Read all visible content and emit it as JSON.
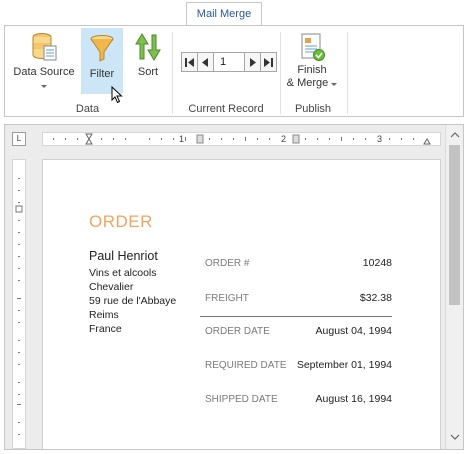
{
  "ribbon": {
    "tab_label": "Mail Merge",
    "groups": {
      "data": {
        "label": "Data",
        "data_source_label": "Data Source",
        "filter_label": "Filter",
        "sort_label": "Sort"
      },
      "current_record": {
        "label": "Current Record",
        "record_value": "1"
      },
      "publish": {
        "label": "Publish",
        "finish_merge_line1": "Finish",
        "finish_merge_line2": "& Merge"
      }
    },
    "accent_color": "#cde6f7"
  },
  "ruler": {
    "corner_label": "L",
    "marks": [
      "1",
      "2",
      "3"
    ]
  },
  "document": {
    "title": "ORDER",
    "title_color": "#f0a55f",
    "customer": {
      "name": "Paul Henriot",
      "lines": [
        "Vins et alcools",
        "Chevalier",
        "59 rue de l'Abbaye",
        "Reims",
        "France"
      ]
    },
    "fields": [
      {
        "label": "ORDER #",
        "value": "10248"
      },
      {
        "label": "FREIGHT",
        "value": "$32.38"
      },
      {
        "label": "ORDER DATE",
        "value": "August 04, 1994"
      },
      {
        "label": "REQUIRED DATE",
        "value": "September 01, 1994"
      },
      {
        "label": "SHIPPED DATE",
        "value": "August 16, 1994"
      }
    ]
  }
}
